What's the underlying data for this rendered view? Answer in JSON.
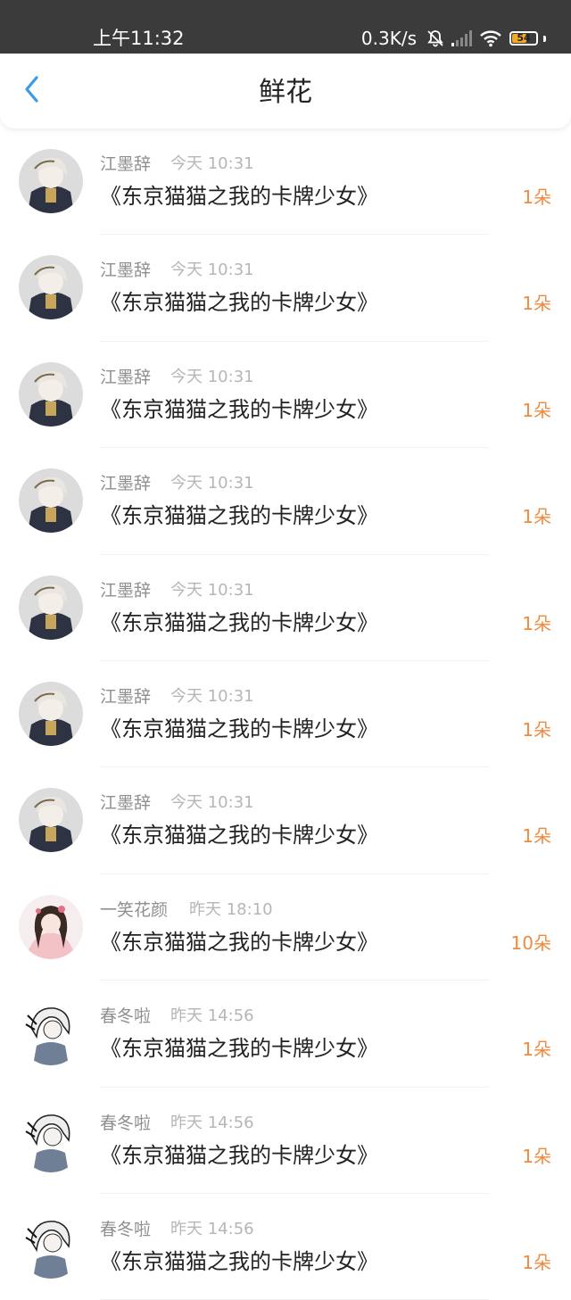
{
  "status_bar": {
    "time": "上午11:32",
    "net_speed": "0.3K/s",
    "battery": "54"
  },
  "header": {
    "title": "鲜花",
    "back_icon": "chevron-left-icon"
  },
  "colors": {
    "accent_blue": "#3a9bea",
    "count_orange": "#f08a3c",
    "battery_fill": "#f2a82a"
  },
  "items": [
    {
      "name": "江墨辞",
      "time": "今天 10:31",
      "book": "《东京猫猫之我的卡牌少女》",
      "count": "1朵",
      "avatar": "dark-knight-avatar"
    },
    {
      "name": "江墨辞",
      "time": "今天 10:31",
      "book": "《东京猫猫之我的卡牌少女》",
      "count": "1朵",
      "avatar": "dark-knight-avatar"
    },
    {
      "name": "江墨辞",
      "time": "今天 10:31",
      "book": "《东京猫猫之我的卡牌少女》",
      "count": "1朵",
      "avatar": "dark-knight-avatar"
    },
    {
      "name": "江墨辞",
      "time": "今天 10:31",
      "book": "《东京猫猫之我的卡牌少女》",
      "count": "1朵",
      "avatar": "dark-knight-avatar"
    },
    {
      "name": "江墨辞",
      "time": "今天 10:31",
      "book": "《东京猫猫之我的卡牌少女》",
      "count": "1朵",
      "avatar": "dark-knight-avatar"
    },
    {
      "name": "江墨辞",
      "time": "今天 10:31",
      "book": "《东京猫猫之我的卡牌少女》",
      "count": "1朵",
      "avatar": "dark-knight-avatar"
    },
    {
      "name": "江墨辞",
      "time": "今天 10:31",
      "book": "《东京猫猫之我的卡牌少女》",
      "count": "1朵",
      "avatar": "dark-knight-avatar"
    },
    {
      "name": "一笑花颜",
      "time": "昨天 18:10",
      "book": "《东京猫猫之我的卡牌少女》",
      "count": "10朵",
      "avatar": "pink-girl-avatar"
    },
    {
      "name": "春冬啦",
      "time": "昨天 14:56",
      "book": "《东京猫猫之我的卡牌少女》",
      "count": "1朵",
      "avatar": "white-hair-avatar"
    },
    {
      "name": "春冬啦",
      "time": "昨天 14:56",
      "book": "《东京猫猫之我的卡牌少女》",
      "count": "1朵",
      "avatar": "white-hair-avatar"
    },
    {
      "name": "春冬啦",
      "time": "昨天 14:56",
      "book": "《东京猫猫之我的卡牌少女》",
      "count": "1朵",
      "avatar": "white-hair-avatar"
    }
  ]
}
